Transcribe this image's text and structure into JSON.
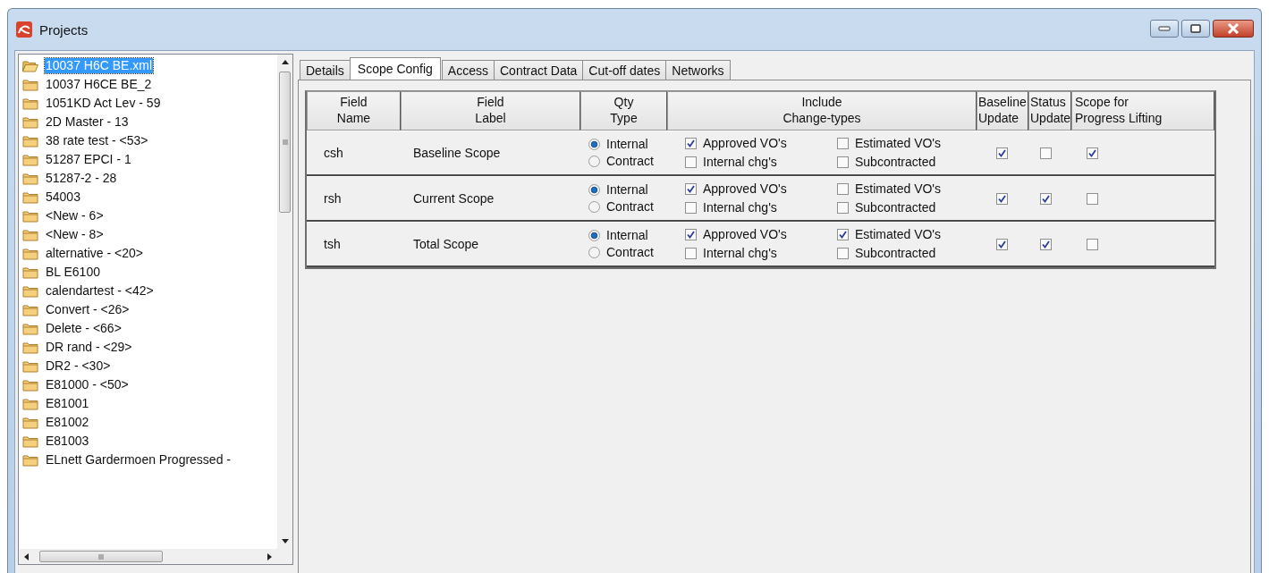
{
  "window": {
    "title": "Projects"
  },
  "tree": {
    "items": [
      {
        "label": "10037 H6C BE.xml",
        "selected": true
      },
      {
        "label": "10037 H6CE BE_2",
        "selected": false
      },
      {
        "label": "1051KD Act Lev - 59",
        "selected": false
      },
      {
        "label": "2D Master - 13",
        "selected": false
      },
      {
        "label": "38 rate test - <53>",
        "selected": false
      },
      {
        "label": "51287 EPCI - 1",
        "selected": false
      },
      {
        "label": "51287-2 - 28",
        "selected": false
      },
      {
        "label": "54003",
        "selected": false
      },
      {
        "label": "<New - 6>",
        "selected": false
      },
      {
        "label": "<New - 8>",
        "selected": false
      },
      {
        "label": "alternative - <20>",
        "selected": false
      },
      {
        "label": "BL E6100",
        "selected": false
      },
      {
        "label": "calendartest - <42>",
        "selected": false
      },
      {
        "label": "Convert - <26>",
        "selected": false
      },
      {
        "label": "Delete - <66>",
        "selected": false
      },
      {
        "label": "DR rand - <29>",
        "selected": false
      },
      {
        "label": "DR2 - <30>",
        "selected": false
      },
      {
        "label": "E81000 - <50>",
        "selected": false
      },
      {
        "label": "E81001",
        "selected": false
      },
      {
        "label": "E81002",
        "selected": false
      },
      {
        "label": "E81003",
        "selected": false
      },
      {
        "label": "ELnett Gardermoen Progressed -",
        "selected": false
      }
    ]
  },
  "tabs": [
    {
      "label": "Details",
      "selected": false
    },
    {
      "label": "Scope Config",
      "selected": true
    },
    {
      "label": "Access",
      "selected": false
    },
    {
      "label": "Contract Data",
      "selected": false
    },
    {
      "label": "Cut-off dates",
      "selected": false
    },
    {
      "label": "Networks",
      "selected": false
    }
  ],
  "table": {
    "columns": [
      "Field\nName",
      "Field\nLabel",
      "Qty\nType",
      "Include\nChange-types",
      "Baseline\nUpdate",
      "Status\nUpdate",
      "Scope for\nProgress Lifting"
    ],
    "rows": [
      {
        "field_name": "csh",
        "field_label": "Baseline Scope",
        "qty_type": [
          {
            "label": "Internal",
            "selected": true
          },
          {
            "label": "Contract",
            "selected": false
          }
        ],
        "change_types": [
          {
            "label": "Approved VO's",
            "checked": true
          },
          {
            "label": "Estimated VO's",
            "checked": false
          },
          {
            "label": "Internal chg's",
            "checked": false
          },
          {
            "label": "Subcontracted",
            "checked": false
          }
        ],
        "baseline_update": true,
        "status_update": false,
        "progress_lifting": true
      },
      {
        "field_name": "rsh",
        "field_label": "Current Scope",
        "qty_type": [
          {
            "label": "Internal",
            "selected": true
          },
          {
            "label": "Contract",
            "selected": false
          }
        ],
        "change_types": [
          {
            "label": "Approved VO's",
            "checked": true
          },
          {
            "label": "Estimated VO's",
            "checked": false
          },
          {
            "label": "Internal chg's",
            "checked": false
          },
          {
            "label": "Subcontracted",
            "checked": false
          }
        ],
        "baseline_update": true,
        "status_update": true,
        "progress_lifting": false
      },
      {
        "field_name": "tsh",
        "field_label": "Total Scope",
        "qty_type": [
          {
            "label": "Internal",
            "selected": true
          },
          {
            "label": "Contract",
            "selected": false
          }
        ],
        "change_types": [
          {
            "label": "Approved VO's",
            "checked": true
          },
          {
            "label": "Estimated VO's",
            "checked": true
          },
          {
            "label": "Internal chg's",
            "checked": false
          },
          {
            "label": "Subcontracted",
            "checked": false
          }
        ],
        "baseline_update": true,
        "status_update": true,
        "progress_lifting": false
      }
    ]
  }
}
